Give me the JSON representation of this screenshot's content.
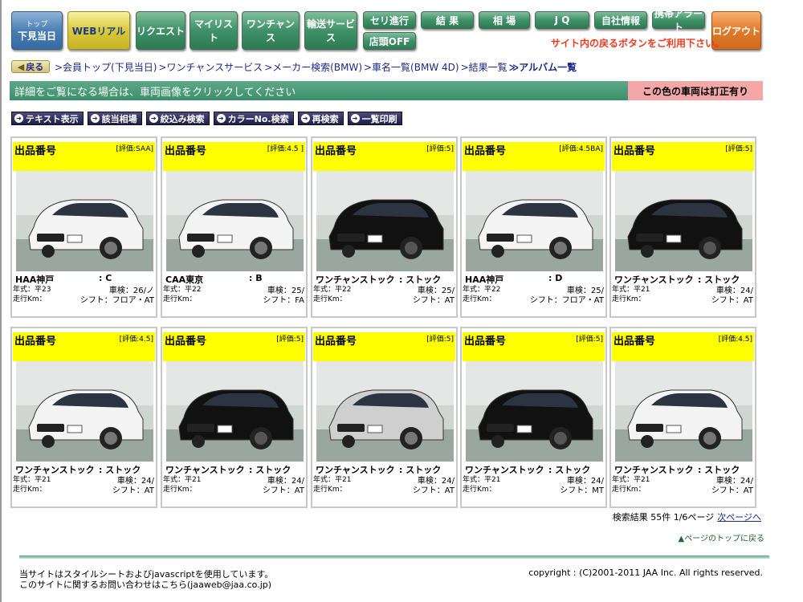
{
  "nav": {
    "top_small": "トップ",
    "top_main": "下見当日",
    "web_real": "WEBリアル",
    "request": "リクエスト",
    "mylist": "マイリスト",
    "onechance": "ワンチャンス",
    "transport": "輸送サービス",
    "seri": "セリ進行",
    "results": "結 果",
    "market": "相 場",
    "jq": "J Q",
    "company": "自社情報",
    "mobile": "携帯アラート",
    "store_off": "店頭OFF",
    "logout": "ログアウト",
    "notice": "サイト内の戻るボタンをご利用下さい。"
  },
  "breadcrumb": {
    "back": "戻る",
    "items": [
      ">会員トップ(下見当日)",
      ">ワンチャンスサービス",
      ">メーカー検索(BMW)",
      ">車名一覧(BMW 4D)",
      ">結果一覧",
      "≫アルバム一覧"
    ]
  },
  "info": {
    "message": "詳細をご覧になる場合は、車両画像をクリックしてください",
    "red_notice": "この色の車両は訂正有り"
  },
  "actions": [
    "テキスト表示",
    "該当相場",
    "絞込み検索",
    "カラーNo.検索",
    "再検索",
    "一覧印刷"
  ],
  "cards": [
    {
      "lot": "出品番号",
      "grade": "[評価:SAA]",
      "auction": "HAA神戸",
      "grade_letter": ": C",
      "year": "年式：平23",
      "shaken": "車検：26/ノ",
      "km": "走行Km：",
      "shift": "シフト：フロア・AT",
      "car_color": "#f4f4f4"
    },
    {
      "lot": "出品番号",
      "grade": "[評価:4.5 ]",
      "auction": "CAA東京",
      "grade_letter": ": B",
      "year": "年式：平22",
      "shaken": "車検：25/",
      "km": "走行Km：",
      "shift": "シフト：FA",
      "car_color": "#f4f4f4"
    },
    {
      "lot": "出品番号",
      "grade": "[評価:5]",
      "auction": "ワンチャンストック",
      "grade_letter": ": ストック",
      "year": "年式：平22",
      "shaken": "車検：25/",
      "km": "走行Km：",
      "shift": "シフト：AT",
      "car_color": "#111111"
    },
    {
      "lot": "出品番号",
      "grade": "[評価:4.5BA]",
      "auction": "HAA神戸",
      "grade_letter": ": D",
      "year": "年式：平22",
      "shaken": "車検：25/",
      "km": "走行Km：",
      "shift": "シフト：フロア・AT",
      "car_color": "#f4f4f4"
    },
    {
      "lot": "出品番号",
      "grade": "[評価:5]",
      "auction": "ワンチャンストック",
      "grade_letter": ": ストック",
      "year": "年式：平21",
      "shaken": "車検：24/",
      "km": "走行Km：",
      "shift": "シフト：AT",
      "car_color": "#111111"
    },
    {
      "lot": "出品番号",
      "grade": "[評価:4.5]",
      "auction": "ワンチャンストック",
      "grade_letter": ": ストック",
      "year": "年式：平21",
      "shaken": "車検：24/",
      "km": "走行Km：",
      "shift": "シフト：AT",
      "car_color": "#f4f4f4"
    },
    {
      "lot": "出品番号",
      "grade": "[評価:5]",
      "auction": "ワンチャンストック",
      "grade_letter": ": ストック",
      "year": "年式：平21",
      "shaken": "車検：24/",
      "km": "走行Km：",
      "shift": "シフト：AT",
      "car_color": "#111111"
    },
    {
      "lot": "出品番号",
      "grade": "[評価:5]",
      "auction": "ワンチャンストック",
      "grade_letter": ": ストック",
      "year": "年式：平21",
      "shaken": "車検：24/",
      "km": "走行Km：",
      "shift": "シフト：AT",
      "car_color": "#cfcfcf"
    },
    {
      "lot": "出品番号",
      "grade": "[評価:5]",
      "auction": "ワンチャンストック",
      "grade_letter": ": ストック",
      "year": "年式：平21",
      "shaken": "車検：24/",
      "km": "走行Km：",
      "shift": "シフト：MT",
      "car_color": "#111111"
    },
    {
      "lot": "出品番号",
      "grade": "[評価:4.5]",
      "auction": "ワンチャンストック",
      "grade_letter": ": ストック",
      "year": "年式：平21",
      "shaken": "車検：24/",
      "km": "走行Km：",
      "shift": "シフト：AT",
      "car_color": "#f4f4f4"
    }
  ],
  "results": {
    "summary": "検索結果 55件 1/6ページ",
    "next": "次ページへ"
  },
  "to_top": "▲ページのトップに戻る",
  "footer": {
    "line1": "当サイトはスタイルシートおよびjavascriptを使用しています。",
    "line2": "このサイトに関するお問い合わせはこちら(jaaweb@jaa.co.jp)",
    "copyright": "copyright : (C)2001-2011  JAA Inc. All rights reserved."
  }
}
